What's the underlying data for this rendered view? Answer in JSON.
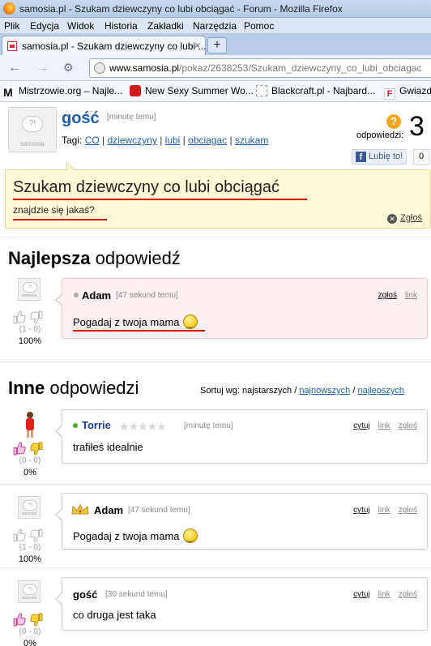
{
  "window": {
    "title": "samosia.pl - Szukam dziewczyny co lubi obciągać - Forum - Mozilla Firefox"
  },
  "menu": [
    "Plik",
    "Edycja",
    "Widok",
    "Historia",
    "Zakładki",
    "Narzędzia",
    "Pomoc"
  ],
  "tab": {
    "label": "samosia.pl - Szukam dziewczyny co lubi ...",
    "close": "×",
    "new_tab": "+"
  },
  "nav": {
    "url_host": "www.samosia.pl",
    "url_path": "/pokaz/2638253/Szukam_dziewczyny_co_lubi_obciagac"
  },
  "bookmarks": [
    {
      "label": "Mistrzowie.org – Najle...",
      "icon": "m-logo-icon"
    },
    {
      "label": "New Sexy Summer Wo...",
      "icon": "youtube-icon"
    },
    {
      "label": "Blackcraft.pl - Najbard...",
      "icon": "page-icon"
    },
    {
      "label": "Gwiazd",
      "icon": "f-logo-icon"
    }
  ],
  "question": {
    "avatar_bubble": "?!",
    "avatar_brand": "samosia",
    "author": "gość",
    "time": "[minutę temu]",
    "tags_label": "Tagi:",
    "tags": [
      "CO",
      "dziewczyny",
      "lubi",
      "obciagac",
      "szukam"
    ],
    "answers_label": "odpowiedzi:",
    "answers_count": "3",
    "like_label": "Lubię to!",
    "like_count": "0",
    "title": "Szukam dziewczyny co lubi obciągać",
    "body": "znajdzie się jakaś?",
    "report": "Zgłoś",
    "help_icon": "question-icon"
  },
  "best_section": {
    "bold": "Najlepsza",
    "rest": " odpowiedź"
  },
  "other_section": {
    "bold": "Inne",
    "rest": " odpowiedzi"
  },
  "sort": {
    "label": "Sortuj wg:",
    "current": "najstarszych",
    "sep": "/",
    "newest": "najnowszych",
    "best": "najlepszych"
  },
  "answers": [
    {
      "author": "Adam",
      "time": "[47 sekund temu]",
      "text": "Pogadaj z twoja mama",
      "links": [
        "zgłoś",
        "link"
      ],
      "score": "(1 - 0)",
      "percent": "100%"
    },
    {
      "author": "Torrie",
      "time": "[minutę temu]",
      "text": "trafiłeś idealnie",
      "links": [
        "cytuj",
        "link",
        "zgłoś"
      ],
      "score": "(0 - 0)",
      "percent": "0%",
      "stars": "★★★★★"
    },
    {
      "author": "Adam",
      "time": "[47 sekund temu]",
      "text": "Pogadaj z twoja mama",
      "links": [
        "cytuj",
        "link",
        "zgłoś"
      ],
      "score": "(1 - 0)",
      "percent": "100%"
    },
    {
      "author": "gość",
      "time": "[30 sekund temu]",
      "text": "co druga jest taka",
      "links": [
        "cytuj",
        "link",
        "zgłoś"
      ],
      "score": "(0 - 0)",
      "percent": "0%"
    }
  ],
  "colors": {
    "link": "#1d5fa6",
    "question_bg": "#fff8d6",
    "best_bg": "#fdf0f0",
    "underline": "#d40000"
  }
}
